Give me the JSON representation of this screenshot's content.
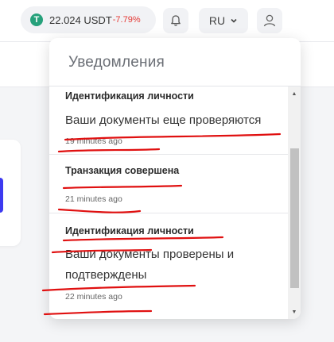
{
  "header": {
    "balance_amount": "22.024 USDT",
    "balance_change": "-7.79%",
    "tether_glyph": "T",
    "language": "RU"
  },
  "icons": {
    "tether": "tether-icon",
    "bell": "bell-icon",
    "chevron": "chevron-down-icon",
    "user": "user-icon"
  },
  "notifications": {
    "title": "Уведомления",
    "items": [
      {
        "heading": "Идентификация личности",
        "body": "Ваши документы еще проверяются",
        "time": "19 minutes ago"
      },
      {
        "heading": "Транзакция совершена",
        "body": "",
        "time": "21 minutes ago"
      },
      {
        "heading": "Идентификация личности",
        "body": "Ваши документы проверены и подтверждены",
        "time": "22 minutes ago"
      }
    ]
  },
  "colors": {
    "accent": "#3d3af0",
    "negative": "#e53935",
    "tether": "#26a17b",
    "annotation": "#e01010"
  }
}
